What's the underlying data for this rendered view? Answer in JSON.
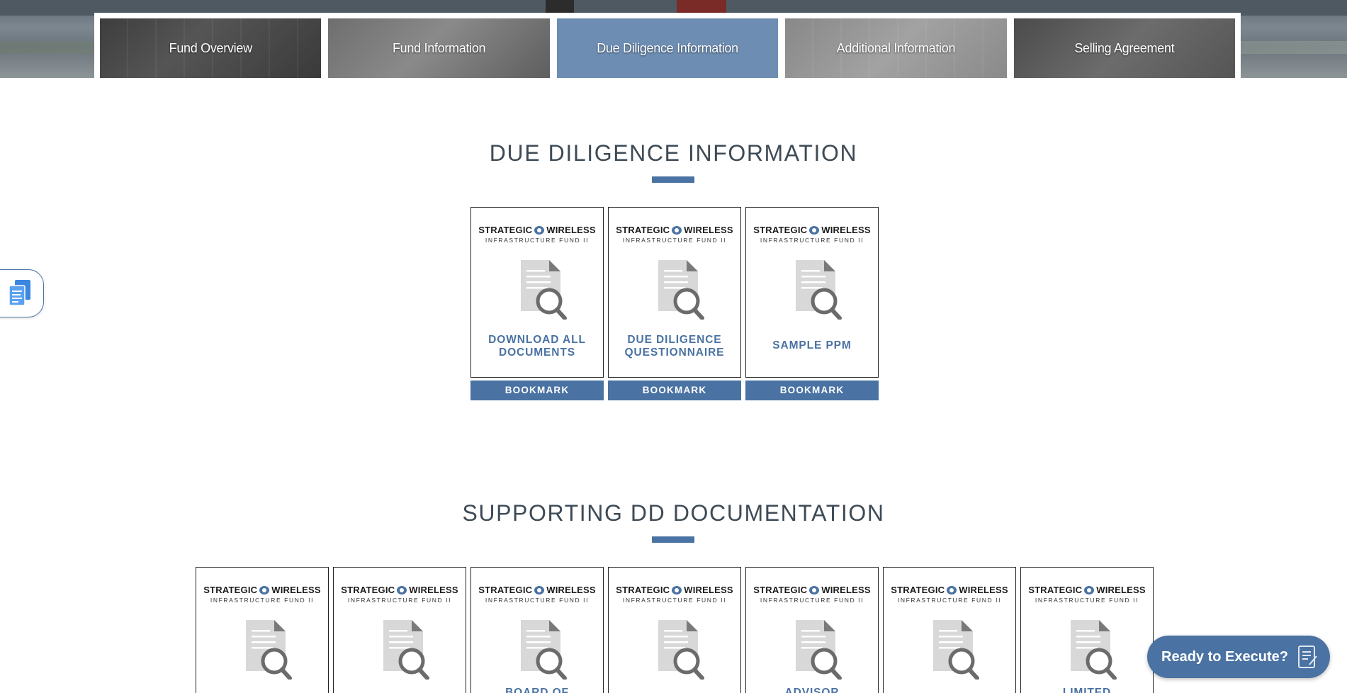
{
  "tabs": [
    {
      "label": "Fund Overview",
      "active": false
    },
    {
      "label": "Fund Information",
      "active": false
    },
    {
      "label": "Due Diligence Information",
      "active": true
    },
    {
      "label": "Additional Information",
      "active": false
    },
    {
      "label": "Selling Agreement",
      "active": false
    }
  ],
  "logo": {
    "line1a": "STRATEGIC",
    "line1b": "WIRELESS",
    "line2": "INFRASTRUCTURE FUND II"
  },
  "due_diligence": {
    "title": "DUE DILIGENCE INFORMATION",
    "bookmark_label": "BOOKMARK",
    "cards": [
      {
        "label": "DOWNLOAD ALL DOCUMENTS",
        "line1": "DOWNLOAD ALL",
        "line2": "DOCUMENTS"
      },
      {
        "label": "DUE DILIGENCE QUESTIONNAIRE",
        "line1": "DUE DILIGENCE",
        "line2": "QUESTIONNAIRE"
      },
      {
        "label": "SAMPLE PPM",
        "line1": "SAMPLE PPM",
        "line2": ""
      }
    ]
  },
  "supporting": {
    "title": "SUPPORTING DD DOCUMENTATION",
    "cards": [
      {
        "label": ""
      },
      {
        "label": ""
      },
      {
        "label": "BOARD OF"
      },
      {
        "label": ""
      },
      {
        "label": "ADVISOR"
      },
      {
        "label": ""
      },
      {
        "label": "LIMITED"
      }
    ]
  },
  "execute_button": {
    "label": "Ready to Execute?"
  },
  "colors": {
    "accent": "#4a72a2",
    "active_tab": "#6d8db3",
    "heading": "#3e4b56"
  }
}
